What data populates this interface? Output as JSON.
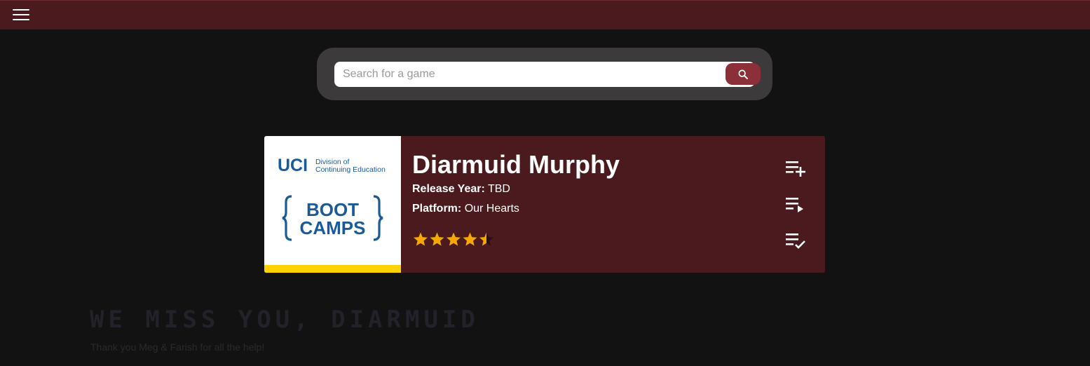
{
  "nav": {
    "menu_icon": "hamburger-menu-icon"
  },
  "search": {
    "placeholder": "Search for a game",
    "value": "",
    "button_icon": "search-icon"
  },
  "game": {
    "title": "Diarmuid Murphy",
    "release_year_label": "Release Year:",
    "release_year": "TBD",
    "platform_label": "Platform:",
    "platform": "Our Hearts",
    "rating": 4.5,
    "rating_max": 5,
    "image": {
      "uci_text": "UCI",
      "division_line1": "Division of",
      "division_line2": "Continuing Education",
      "boot_text": "BOOT",
      "camps_text": "CAMPS"
    },
    "actions": [
      {
        "name": "add-to-list-icon"
      },
      {
        "name": "playing-list-icon"
      },
      {
        "name": "completed-list-icon"
      }
    ]
  },
  "tribute": {
    "title": "WE MISS YOU, DIARMUID",
    "subtitle": "Thank you Meg & Farish for all the help!"
  },
  "colors": {
    "topbar": "#4b1a1f",
    "background": "#121212",
    "card": "#4b1a1f",
    "search_button": "#8b2f38",
    "star": "#f5a800",
    "logo_blue": "#1a5a9a",
    "logo_yellow": "#ffd200"
  }
}
